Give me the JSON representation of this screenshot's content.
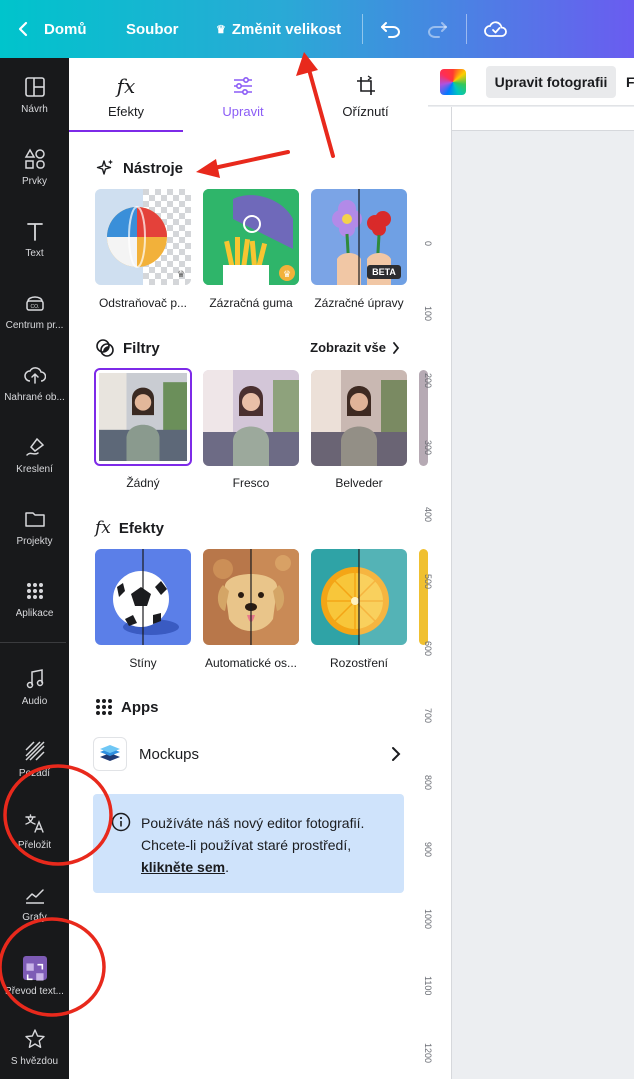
{
  "topbar": {
    "home_label": "Domů",
    "file_label": "Soubor",
    "resize_label": "Změnit velikost"
  },
  "rail": {
    "items": [
      {
        "label": "Návrh",
        "icon": "layout-icon"
      },
      {
        "label": "Prvky",
        "icon": "shapes-icon"
      },
      {
        "label": "Text",
        "icon": "text-icon"
      },
      {
        "label": "Centrum pr...",
        "icon": "brand-icon"
      },
      {
        "label": "Nahrané ob...",
        "icon": "cloud-upload-icon"
      },
      {
        "label": "Kreslení",
        "icon": "draw-icon"
      },
      {
        "label": "Projekty",
        "icon": "folder-icon"
      },
      {
        "label": "Aplikace",
        "icon": "apps-grid-icon"
      },
      {
        "label": "Audio",
        "icon": "music-note-icon"
      },
      {
        "label": "Pozadí",
        "icon": "background-icon"
      },
      {
        "label": "Přeložit",
        "icon": "translate-icon"
      },
      {
        "label": "Grafy",
        "icon": "chart-icon"
      },
      {
        "label": "Převod text...",
        "icon": "text-convert-icon"
      },
      {
        "label": "S hvězdou",
        "icon": "star-icon"
      }
    ]
  },
  "panel": {
    "tabs": [
      {
        "label": "Efekty",
        "icon": "fx-icon"
      },
      {
        "label": "Upravit",
        "icon": "sliders-icon"
      },
      {
        "label": "Oříznutí",
        "icon": "crop-icon"
      }
    ],
    "tools": {
      "heading": "Nástroje",
      "items": [
        {
          "label": "Odstraňovač p..."
        },
        {
          "label": "Zázračná guma"
        },
        {
          "label": "Zázračné úpravy",
          "badge": "BETA"
        }
      ]
    },
    "filters": {
      "heading": "Filtry",
      "show_all": "Zobrazit vše",
      "items": [
        {
          "label": "Žádný"
        },
        {
          "label": "Fresco"
        },
        {
          "label": "Belveder"
        }
      ]
    },
    "effects": {
      "heading": "Efekty",
      "items": [
        {
          "label": "Stíny"
        },
        {
          "label": "Automatické os..."
        },
        {
          "label": "Rozostření"
        }
      ]
    },
    "apps": {
      "heading": "Apps",
      "mockups_label": "Mockups"
    },
    "info": {
      "text": "Používáte náš nový editor fotografií. Chcete-li používat staré prostředí, ",
      "link": "klikněte sem",
      "suffix": "."
    }
  },
  "canvas": {
    "edit_photo_label": "Upravit fotografii",
    "cut_label": "F",
    "ruler_ticks": [
      "0",
      "100",
      "200",
      "300",
      "400",
      "500",
      "600",
      "700",
      "800",
      "900",
      "1000",
      "1100",
      "1200"
    ]
  },
  "colors": {
    "accent": "#7d2ae8",
    "annotation": "#e8291c",
    "info_bg": "#cfe3fb"
  }
}
